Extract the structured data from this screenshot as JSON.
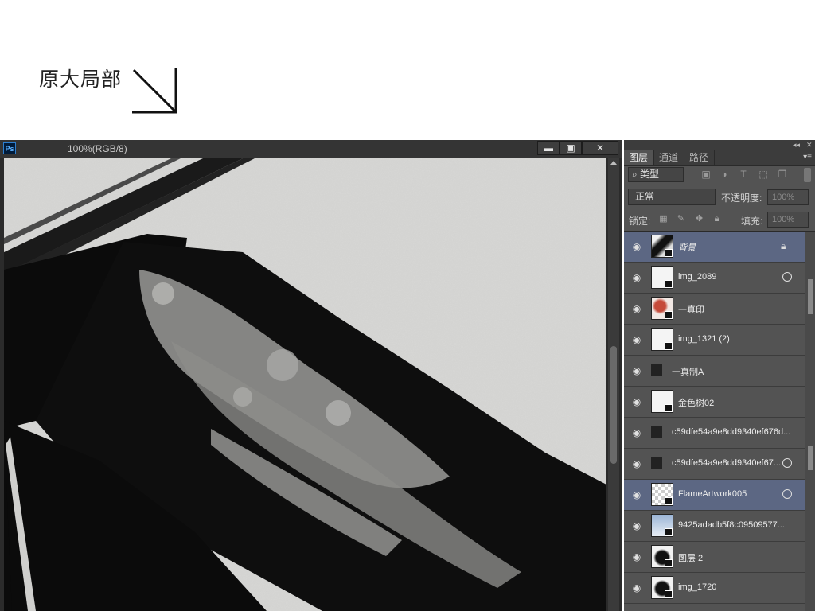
{
  "caption": "原大局部",
  "document": {
    "app_icon": "Ps",
    "title": "100%(RGB/8)",
    "buttons": {
      "minimize": "▬",
      "maximize": "▣",
      "close": "✕"
    }
  },
  "panel": {
    "collapse": "◂◂",
    "close": "✕",
    "tabs": [
      {
        "label": "图层",
        "active": true
      },
      {
        "label": "通道",
        "active": false
      },
      {
        "label": "路径",
        "active": false
      }
    ],
    "menu_icon": "▾≡",
    "filter": {
      "label": "⌕ 类型",
      "icons": [
        "image-filter-icon",
        "adjustment-filter-icon",
        "type-filter-icon",
        "shape-filter-icon",
        "smartobject-filter-icon"
      ]
    },
    "blend_mode": "正常",
    "opacity_label": "不透明度:",
    "opacity_value": "100%",
    "lock_label": "锁定:",
    "fill_label": "填充:",
    "fill_value": "100%",
    "layers": [
      {
        "name": "背景",
        "italic": true,
        "selected": true,
        "badge": "lock",
        "thumb": "dark-brush"
      },
      {
        "name": "img_2089",
        "italic": false,
        "selected": false,
        "badge": "fx",
        "thumb": "smart"
      },
      {
        "name": "一真印",
        "italic": false,
        "selected": false,
        "badge": "",
        "thumb": "seal"
      },
      {
        "name": "img_1321 (2)",
        "italic": false,
        "selected": false,
        "badge": "",
        "thumb": "smart"
      },
      {
        "name": "一真制A",
        "italic": false,
        "selected": false,
        "badge": "",
        "thumb": "none"
      },
      {
        "name": "金色树02",
        "italic": false,
        "selected": false,
        "badge": "",
        "thumb": "smart"
      },
      {
        "name": "c59dfe54a9e8dd9340ef676d...",
        "italic": false,
        "selected": false,
        "badge": "",
        "thumb": "none"
      },
      {
        "name": "c59dfe54a9e8dd9340ef67...",
        "italic": false,
        "selected": false,
        "badge": "fx",
        "thumb": "none"
      },
      {
        "name": "FlameArtwork005",
        "italic": false,
        "selected": true,
        "badge": "fx",
        "thumb": "checker"
      },
      {
        "name": "9425adadb5f8c09509577...",
        "italic": false,
        "selected": false,
        "badge": "",
        "thumb": "blue"
      },
      {
        "name": "图层 2",
        "italic": false,
        "selected": false,
        "badge": "",
        "thumb": "ink"
      },
      {
        "name": "img_1720",
        "italic": false,
        "selected": false,
        "badge": "",
        "thumb": "ink"
      }
    ]
  },
  "colors": {
    "panel_bg": "#535353",
    "selected_row": "#5c6783",
    "window_dark": "#2b2b2b"
  }
}
